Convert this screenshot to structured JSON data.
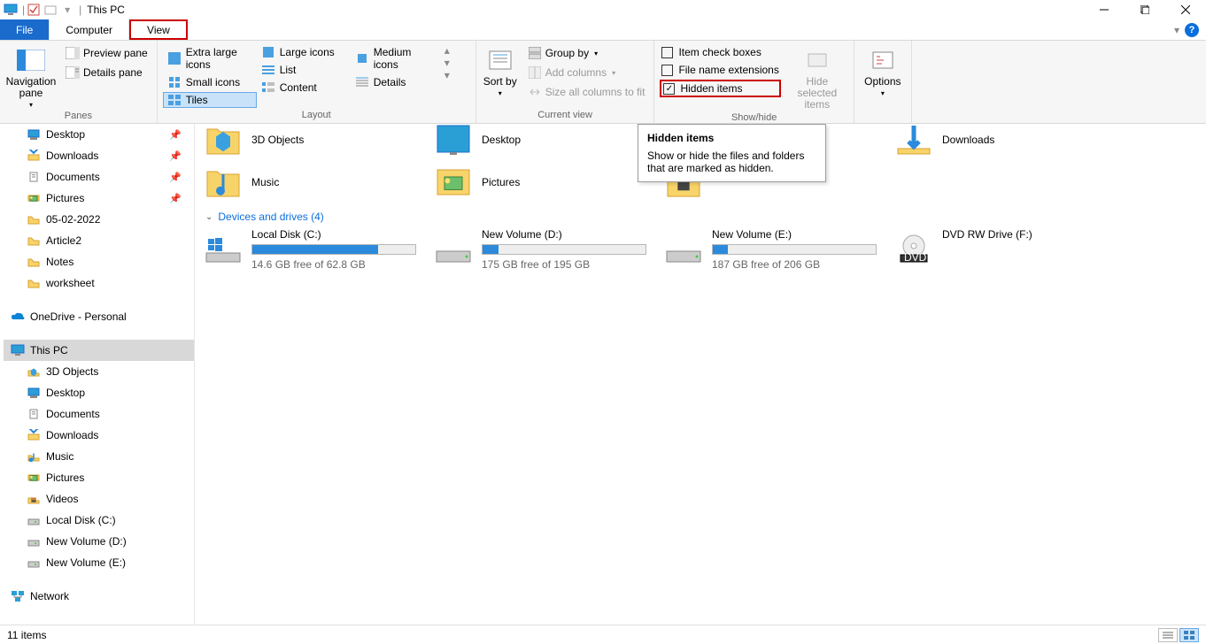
{
  "title": "This PC",
  "tabs": {
    "file": "File",
    "computer": "Computer",
    "view": "View"
  },
  "ribbon": {
    "panes": {
      "caption": "Panes",
      "navigation": "Navigation pane",
      "preview": "Preview pane",
      "details": "Details pane"
    },
    "layout": {
      "caption": "Layout",
      "xlarge": "Extra large icons",
      "large": "Large icons",
      "medium": "Medium icons",
      "small": "Small icons",
      "list": "List",
      "details": "Details",
      "tiles": "Tiles",
      "content": "Content"
    },
    "currentview": {
      "caption": "Current view",
      "sortby": "Sort by",
      "groupby": "Group by",
      "addcols": "Add columns",
      "sizecols": "Size all columns to fit"
    },
    "showhide": {
      "caption": "Show/hide",
      "itemcheck": "Item check boxes",
      "fileext": "File name extensions",
      "hidden": "Hidden items",
      "hidesel": "Hide selected items"
    },
    "options": "Options"
  },
  "tooltip": {
    "title": "Hidden items",
    "body": "Show or hide the files and folders that are marked as hidden."
  },
  "nav": {
    "quick": [
      {
        "label": "Desktop",
        "icon": "desktop",
        "pin": true
      },
      {
        "label": "Downloads",
        "icon": "download",
        "pin": true
      },
      {
        "label": "Documents",
        "icon": "document",
        "pin": true
      },
      {
        "label": "Pictures",
        "icon": "picture",
        "pin": true
      },
      {
        "label": "05-02-2022",
        "icon": "folder"
      },
      {
        "label": "Article2",
        "icon": "folder"
      },
      {
        "label": "Notes",
        "icon": "folder"
      },
      {
        "label": "worksheet",
        "icon": "folder"
      }
    ],
    "onedrive": "OneDrive - Personal",
    "thispc": "This PC",
    "pcitems": [
      {
        "label": "3D Objects",
        "icon": "3d"
      },
      {
        "label": "Desktop",
        "icon": "desktop"
      },
      {
        "label": "Documents",
        "icon": "document"
      },
      {
        "label": "Downloads",
        "icon": "download"
      },
      {
        "label": "Music",
        "icon": "music"
      },
      {
        "label": "Pictures",
        "icon": "picture"
      },
      {
        "label": "Videos",
        "icon": "video"
      },
      {
        "label": "Local Disk (C:)",
        "icon": "drive"
      },
      {
        "label": "New Volume (D:)",
        "icon": "drive"
      },
      {
        "label": "New Volume (E:)",
        "icon": "drive"
      }
    ],
    "network": "Network"
  },
  "main": {
    "folders_top": [
      {
        "label": "3D Objects",
        "icon": "3d"
      },
      {
        "label": "Desktop",
        "icon": "desktop"
      },
      {
        "label": "",
        "icon": ""
      },
      {
        "label": "Downloads",
        "icon": "download"
      }
    ],
    "folders_bot": [
      {
        "label": "Music",
        "icon": "music"
      },
      {
        "label": "Pictures",
        "icon": "picture"
      },
      {
        "label": "",
        "icon": "video"
      },
      {
        "label": "",
        "icon": ""
      }
    ],
    "devices_header": "Devices and drives (4)",
    "drives": [
      {
        "label": "Local Disk (C:)",
        "sub": "14.6 GB free of 62.8 GB",
        "fill": 77,
        "icon": "win"
      },
      {
        "label": "New Volume (D:)",
        "sub": "175 GB free of 195 GB",
        "fill": 10,
        "icon": "hdd"
      },
      {
        "label": "New Volume (E:)",
        "sub": "187 GB free of 206 GB",
        "fill": 9,
        "icon": "hdd"
      },
      {
        "label": "DVD RW Drive (F:)",
        "sub": "",
        "fill": -1,
        "icon": "dvd"
      }
    ]
  },
  "status": {
    "items": "11 items"
  }
}
